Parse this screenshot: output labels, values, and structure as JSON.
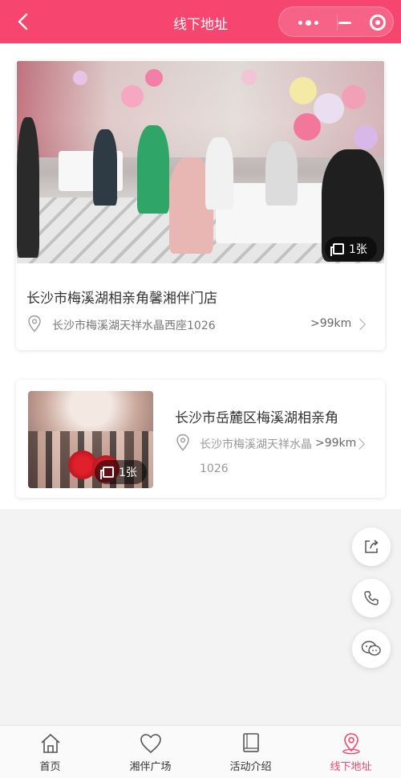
{
  "header": {
    "title": "线下地址",
    "back_icon": "chevron-left-icon",
    "capsule": {
      "more_icon": "more-dots-icon",
      "minimize_icon": "minimize-icon",
      "close_icon": "target-close-icon"
    }
  },
  "colors": {
    "brand": "#f6466f",
    "muted_text": "#999999",
    "card_bg": "#ffffff",
    "page_bg": "#f3f3f3"
  },
  "stores": [
    {
      "name": "长沙市梅溪湖相亲角馨湘伴门店",
      "address": "长沙市梅溪湖天祥水晶西座1026",
      "distance": ">99km",
      "photo_count": "1张"
    },
    {
      "name": "长沙市岳麓区梅溪湖相亲角",
      "address": "长沙市梅溪湖天祥水晶1026",
      "distance": ">99km",
      "photo_count": "1张"
    }
  ],
  "fabs": [
    {
      "icon": "share-icon"
    },
    {
      "icon": "phone-icon"
    },
    {
      "icon": "wechat-icon"
    }
  ],
  "tabbar": {
    "tabs": [
      {
        "label": "首页",
        "icon": "home-icon"
      },
      {
        "label": "湘伴广场",
        "icon": "heart-icon"
      },
      {
        "label": "活动介绍",
        "icon": "book-icon"
      },
      {
        "label": "线下地址",
        "icon": "location-pin-icon",
        "active": true
      }
    ]
  }
}
